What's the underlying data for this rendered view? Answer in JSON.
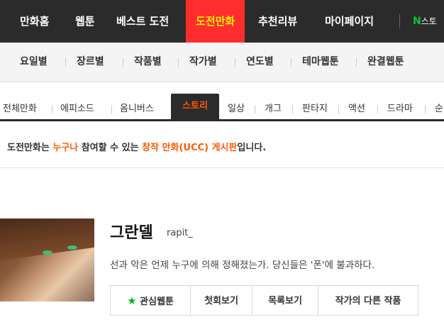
{
  "gnb": {
    "items": [
      "만화홈",
      "웹툰",
      "베스트 도전",
      "도전만화",
      "추천리뷰",
      "마이페이지"
    ],
    "store_letter": "N",
    "store_label": "스토"
  },
  "lnb": {
    "items": [
      "요일별",
      "장르별",
      "작품별",
      "작가별",
      "연도별",
      "테마웹툰",
      "완결웹툰"
    ]
  },
  "genre": {
    "items": [
      "전체만화",
      "에피소드",
      "옴니버스",
      "스토리",
      "일상",
      "개그",
      "판타지",
      "액션",
      "드라마",
      "순"
    ]
  },
  "notice": {
    "part1": "도전만화는 ",
    "hl1": "누구나",
    "part2": " 참여할 수 있는 ",
    "hl2": "창작 만화(UCC) 게시판",
    "part3": "입니다."
  },
  "comic": {
    "title": "그란델",
    "author": "rapit_",
    "description": "선과 악은 언제 누구에 의해 정해졌는가. 당신들은 '폰'에 불과하다."
  },
  "buttons": {
    "favorite": "관심웹툰",
    "first": "첫회보기",
    "list": "목록보기",
    "other": "작가의 다른 작품"
  },
  "colors": {
    "active_tab_bg": "#ff2d2d",
    "highlight": "#ff5a00",
    "favorite_star": "#00b41e"
  }
}
